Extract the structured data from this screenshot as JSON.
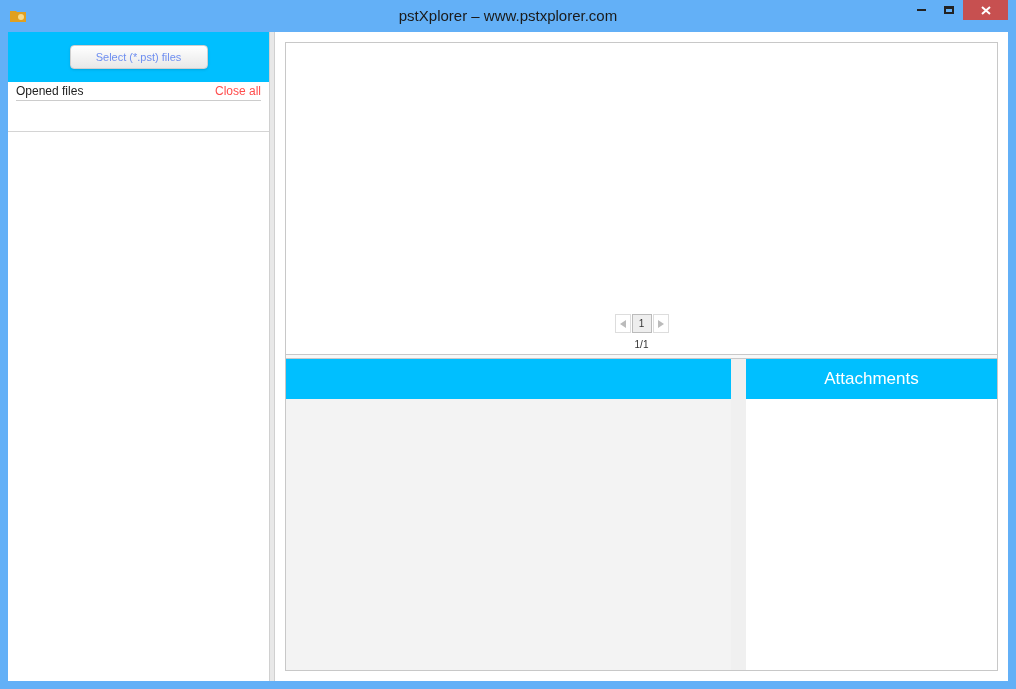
{
  "window": {
    "title": "pstXplorer – www.pstxplorer.com"
  },
  "sidebar": {
    "select_button": "Select (*.pst) files",
    "opened_files_label": "Opened files",
    "close_all": "Close all"
  },
  "pager": {
    "pages": [
      {
        "label": "1",
        "selected": true
      }
    ],
    "prev_disabled": true,
    "next_disabled": true,
    "position": "1/1"
  },
  "attachments": {
    "title": "Attachments"
  }
}
